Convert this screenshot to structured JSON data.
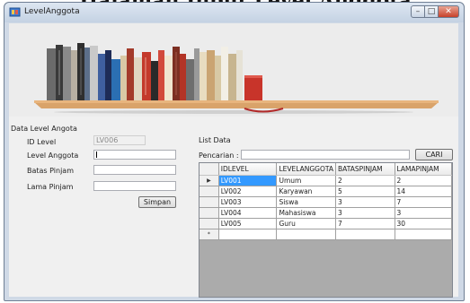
{
  "page_heading": "...Halaman Input Level Anggota",
  "window": {
    "title": "LevelAnggota",
    "buttons": {
      "minimize": "–",
      "maximize": "□",
      "close": "✕"
    }
  },
  "form": {
    "group_label": "Data Level Angota",
    "id_level_label": "ID Level",
    "id_level_value": "LV006",
    "level_anggota_label": "Level Anggota",
    "level_anggota_value": "",
    "batas_pinjam_label": "Batas Pinjam",
    "batas_pinjam_value": "",
    "lama_pinjam_label": "Lama Pinjam",
    "lama_pinjam_value": "",
    "save_label": "Simpan"
  },
  "list": {
    "group_label": "List Data",
    "search_label": "Pencarian :",
    "search_value": "",
    "search_button_label": "CARI",
    "columns": [
      "IDLEVEL",
      "LEVELANGGOTA",
      "BATASPINJAM",
      "LAMAPINJAM"
    ],
    "rows": [
      [
        "LV001",
        "Umum",
        "2",
        "2"
      ],
      [
        "LV002",
        "Karyawan",
        "5",
        "14"
      ],
      [
        "LV003",
        "Siswa",
        "3",
        "7"
      ],
      [
        "LV004",
        "Mahasiswa",
        "3",
        "3"
      ],
      [
        "LV005",
        "Guru",
        "7",
        "30"
      ]
    ],
    "selected_row_marker": "▶",
    "new_row_marker": "*"
  },
  "colors": {
    "selection": "#3399ff",
    "grid_background": "#ababab",
    "shelf": "#d9a36a"
  }
}
